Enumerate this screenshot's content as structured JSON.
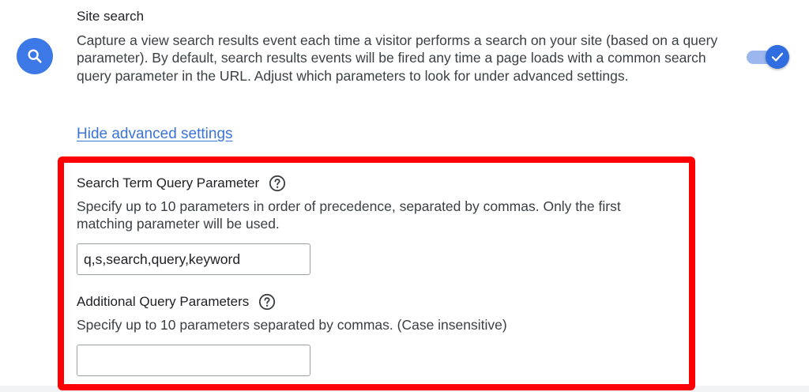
{
  "site_search": {
    "title": "Site search",
    "description": "Capture a view search results event each time a visitor performs a search on your site (based on a query parameter). By default, search results events will be fired any time a page loads with a common search query parameter in the URL. Adjust which parameters to look for under advanced settings.",
    "enabled": true,
    "icon": "search-icon"
  },
  "advanced": {
    "link_label": "Hide advanced settings"
  },
  "search_term_param": {
    "label": "Search Term Query Parameter",
    "description": "Specify up to 10 parameters in order of precedence, separated by commas. Only the first matching parameter will be used.",
    "value": "q,s,search,query,keyword"
  },
  "additional_params": {
    "label": "Additional Query Parameters",
    "description": "Specify up to 10 parameters separated by commas. (Case insensitive)",
    "value": ""
  },
  "colors": {
    "accent_blue": "#3c78e6",
    "link_blue": "#3b73d9",
    "highlight_red": "#ff0000"
  }
}
